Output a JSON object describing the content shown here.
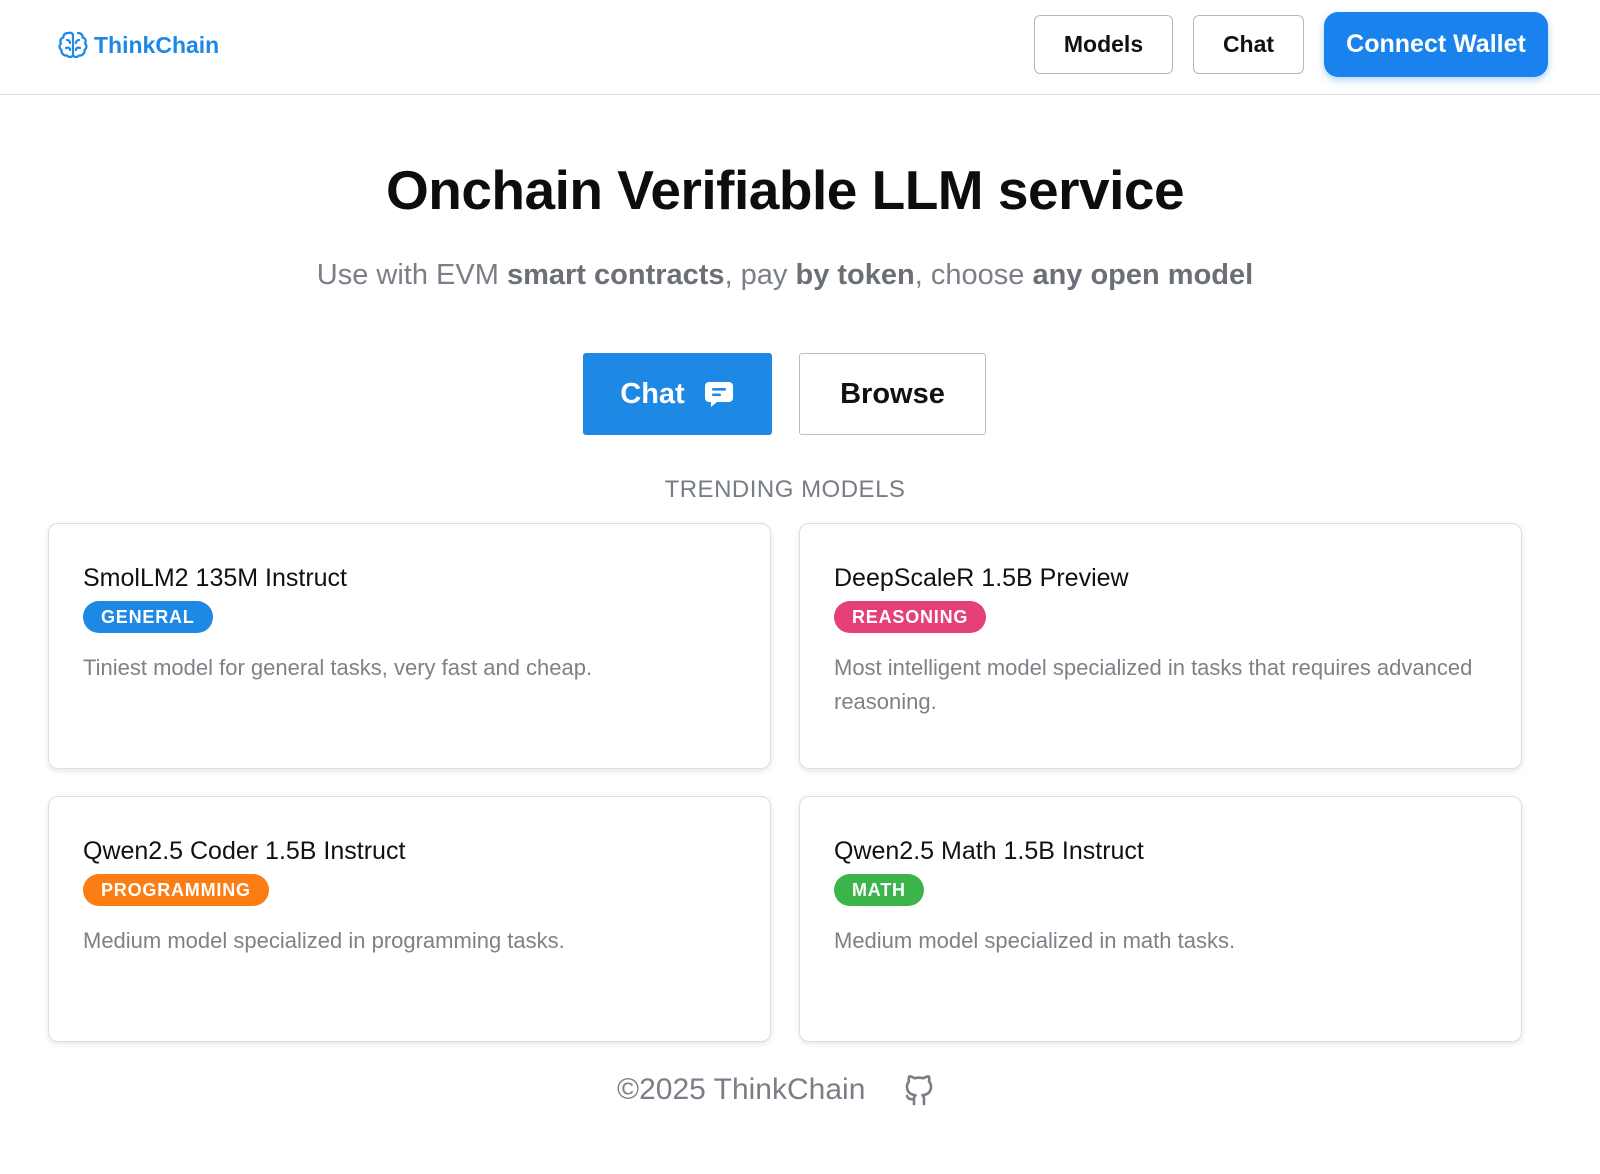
{
  "header": {
    "brand": "ThinkChain",
    "nav_models": "Models",
    "nav_chat": "Chat",
    "connect_wallet": "Connect Wallet"
  },
  "hero": {
    "title": "Onchain Verifiable LLM service",
    "subtitle_parts": {
      "p1": "Use with EVM ",
      "b1": "smart contracts",
      "p2": ", pay ",
      "b2": "by token",
      "p3": ", choose ",
      "b3": "any open model"
    },
    "chat_button": "Chat",
    "browse_button": "Browse"
  },
  "trending": {
    "heading": "TRENDING MODELS",
    "models": [
      {
        "name": "SmolLM2 135M Instruct",
        "tag": "GENERAL",
        "tag_color": "#1e88e5",
        "description": "Tiniest model for general tasks, very fast and cheap."
      },
      {
        "name": "DeepScaleR 1.5B Preview",
        "tag": "REASONING",
        "tag_color": "#e5407a",
        "description": "Most intelligent model specialized in tasks that requires advanced reasoning."
      },
      {
        "name": "Qwen2.5 Coder 1.5B Instruct",
        "tag": "PROGRAMMING",
        "tag_color": "#fb7d14",
        "description": "Medium model specialized in programming tasks."
      },
      {
        "name": "Qwen2.5 Math 1.5B Instruct",
        "tag": "MATH",
        "tag_color": "#3cb44b",
        "description": "Medium model specialized in math tasks."
      }
    ]
  },
  "footer": {
    "copyright": "©2025 ThinkChain",
    "github_icon": "github-icon"
  },
  "colors": {
    "accent": "#1e88e5",
    "muted_text": "#7a7f87"
  }
}
